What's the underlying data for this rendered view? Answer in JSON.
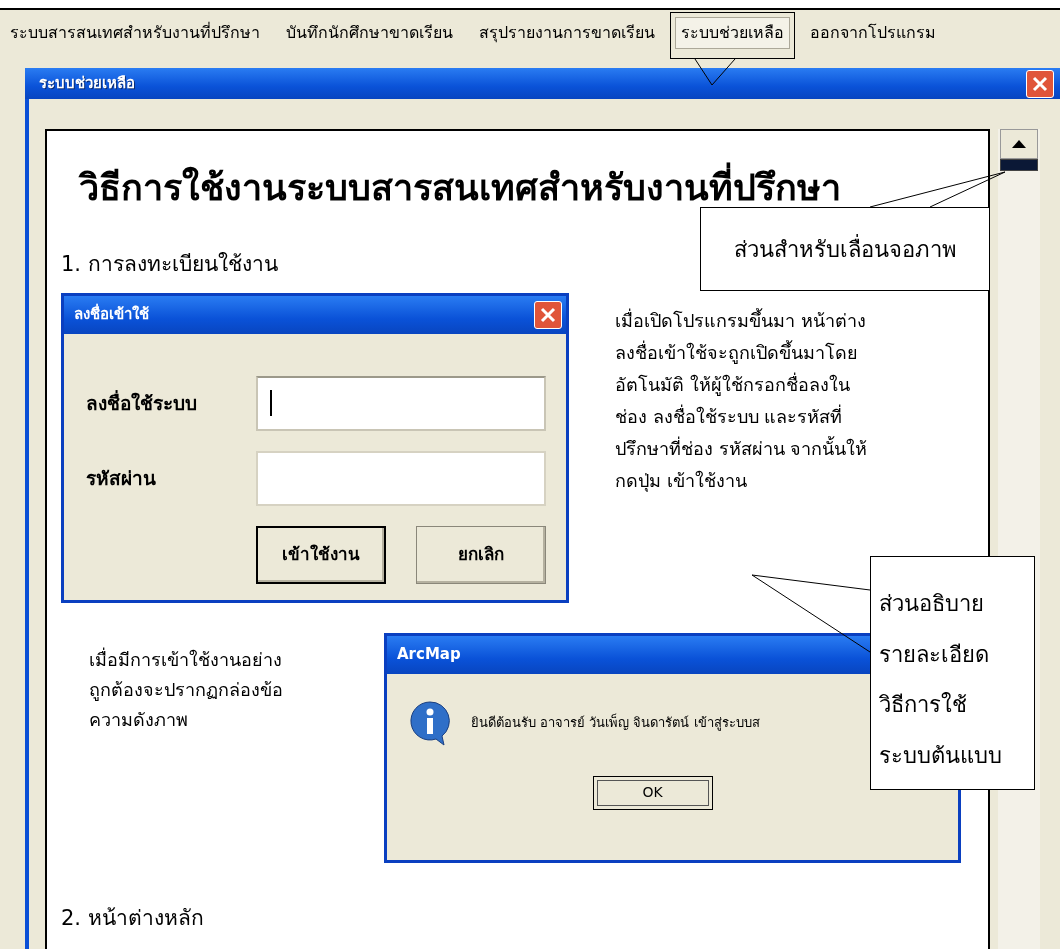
{
  "menu": [
    {
      "label": "ระบบสารสนเทศสำหรับงานที่ปรึกษา",
      "selected": false
    },
    {
      "label": "บันทึกนักศึกษาขาดเรียน",
      "selected": false
    },
    {
      "label": "สรุปรายงานการขาดเรียน",
      "selected": false
    },
    {
      "label": "ระบบช่วยเหลือ",
      "selected": true
    },
    {
      "label": "ออกจากโปรแกรม",
      "selected": false
    }
  ],
  "window": {
    "title": "ระบบช่วยเหลือ"
  },
  "help": {
    "title": "วิธีการใช้งานระบบสารสนเทศสำหรับงานที่ปรึกษา",
    "section_1": "1. การลงทะเบียนใช้งาน",
    "login_dialog": {
      "title": "ลงชื่อเข้าใช้",
      "fields": [
        {
          "label": "ลงชื่อใช้ระบบ",
          "focused": true
        },
        {
          "label": "รหัสผ่าน",
          "focused": false
        }
      ],
      "buttons": [
        {
          "label": "เข้าใช้งาน",
          "default": true
        },
        {
          "label": "ยกเลิก",
          "default": false
        }
      ]
    },
    "login_text": [
      "เมื่อเปิดโปรแกรมขึ้นมา หน้าต่าง",
      "ลงชื่อเข้าใช้จะถูกเปิดขึ้นมาโดย",
      "อัตโนมัติ ให้ผู้ใช้กรอกชื่อลงใน",
      "ช่อง ลงชื่อใช้ระบบ และรหัสที่",
      "ปรึกษาที่ช่อง รหัสผ่าน จากนั้นให้",
      "กดปุ่ม เข้าใช้งาน"
    ],
    "success_text": [
      "เมื่อมีการเข้าใช้งานอย่าง",
      "ถูกต้องจะปรากฏกล่องข้อ",
      "ความดังภาพ"
    ],
    "message_dialog": {
      "title": "ArcMap",
      "message": "ยินดีต้อนรับ อาจารย์ วันเพ็ญ จินดารัตน์ เข้าสู่ระบบส",
      "button": "OK"
    },
    "section_2": "2. หน้าต่างหลัก"
  },
  "callouts": [
    {
      "kind": "frame"
    },
    {
      "kind": "text",
      "lines": [
        "ส่วนสำหรับเลื่อนจอภาพ"
      ]
    },
    {
      "kind": "text",
      "lines": [
        "ส่วนอธิบาย",
        "รายละเอียด",
        "วิธีการใช้",
        "ระบบต้นแบบ"
      ]
    }
  ]
}
